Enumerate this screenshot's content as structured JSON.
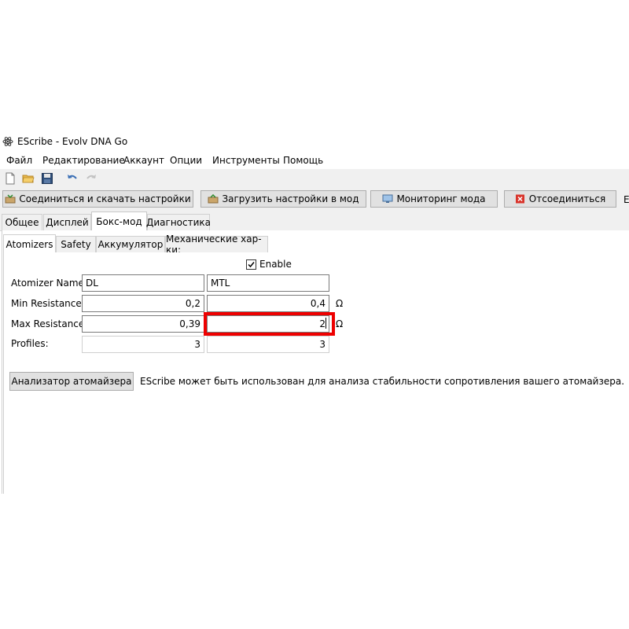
{
  "window": {
    "title": "EScribe - Evolv DNA Go"
  },
  "menu": {
    "items": [
      "Файл",
      "Редактирование",
      "Аккаунт",
      "Опции",
      "Инструменты",
      "Помощь"
    ]
  },
  "toolbar": {
    "icons": [
      "new-file-icon",
      "open-folder-icon",
      "save-icon",
      "undo-icon",
      "redo-icon"
    ]
  },
  "actions": {
    "connect": "Соединиться и скачать настройки",
    "upload": "Загрузить настройки в мод",
    "monitor": "Мониторинг мода",
    "disconnect": "Отсоединиться",
    "overflow": "Е"
  },
  "main_tabs": [
    "Общее",
    "Дисплей",
    "Бокс-мод",
    "Диагностика"
  ],
  "main_tab_active": "Бокс-мод",
  "sub_tabs": [
    "Atomizers",
    "Safety",
    "Аккумулятор",
    "Механические хар-ки:"
  ],
  "sub_tab_active": "Atomizers",
  "atomizers": {
    "enable_label": "Enable",
    "enable_checked": true,
    "labels": {
      "name": "Atomizer Name:",
      "min": "Min Resistance:",
      "max": "Max Resistance:",
      "profiles": "Profiles:"
    },
    "col1": {
      "name": "DL",
      "min": "0,2",
      "max": "0,39",
      "profiles": "3"
    },
    "col2": {
      "name": "MTL",
      "min": "0,4",
      "max": "2",
      "profiles": "3"
    },
    "unit": "Ω"
  },
  "analyzer": {
    "button": "Анализатор атомайзера",
    "description": "EScribe может быть использован для анализа стабильности сопротивления вашего атомайзера."
  },
  "colors": {
    "highlight": "#ee0000",
    "button_bg": "#e1e1e1",
    "toolbar_bg": "#f0f0f0"
  }
}
